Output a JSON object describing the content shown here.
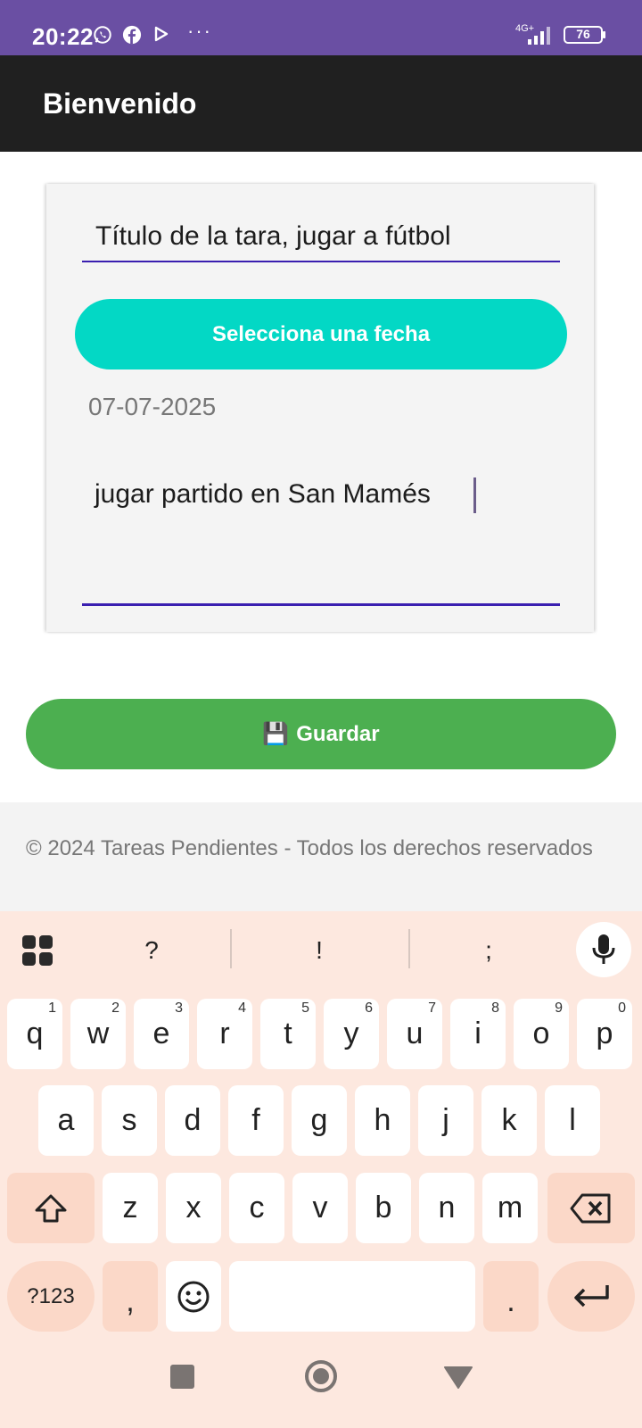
{
  "status_bar": {
    "time": "20:22",
    "network": "4G+",
    "battery": "76",
    "more": "···",
    "icons": [
      "whatsapp-icon",
      "facebook-icon",
      "play-icon",
      "signal-icon",
      "battery-icon"
    ]
  },
  "app_bar": {
    "title": "Bienvenido"
  },
  "form": {
    "title_value": "Título de la tara, jugar a fútbol",
    "date_button_label": "Selecciona una fecha",
    "date_value": "07-07-2025",
    "description_value": "jugar partido en San Mamés"
  },
  "save_button": {
    "icon": "💾",
    "label": "Guardar"
  },
  "footer": {
    "text": "© 2024 Tareas Pendientes - Todos los derechos reservados"
  },
  "keyboard": {
    "suggestions": [
      "?",
      "!",
      ";"
    ],
    "row1": [
      "q",
      "w",
      "e",
      "r",
      "t",
      "y",
      "u",
      "i",
      "o",
      "p"
    ],
    "row1_hints": [
      "1",
      "2",
      "3",
      "4",
      "5",
      "6",
      "7",
      "8",
      "9",
      "0"
    ],
    "row2": [
      "a",
      "s",
      "d",
      "f",
      "g",
      "h",
      "j",
      "k",
      "l"
    ],
    "row3": [
      "z",
      "x",
      "c",
      "v",
      "b",
      "n",
      "m"
    ],
    "symbols_label": "?123",
    "comma": ",",
    "period": "."
  },
  "colors": {
    "status_bar": "#6a4fa3",
    "app_bar": "#202020",
    "date_button": "#03d8c5",
    "save_button": "#4caf50",
    "input_underline": "#3a1fb0",
    "keyboard_bg": "#fde8df"
  }
}
